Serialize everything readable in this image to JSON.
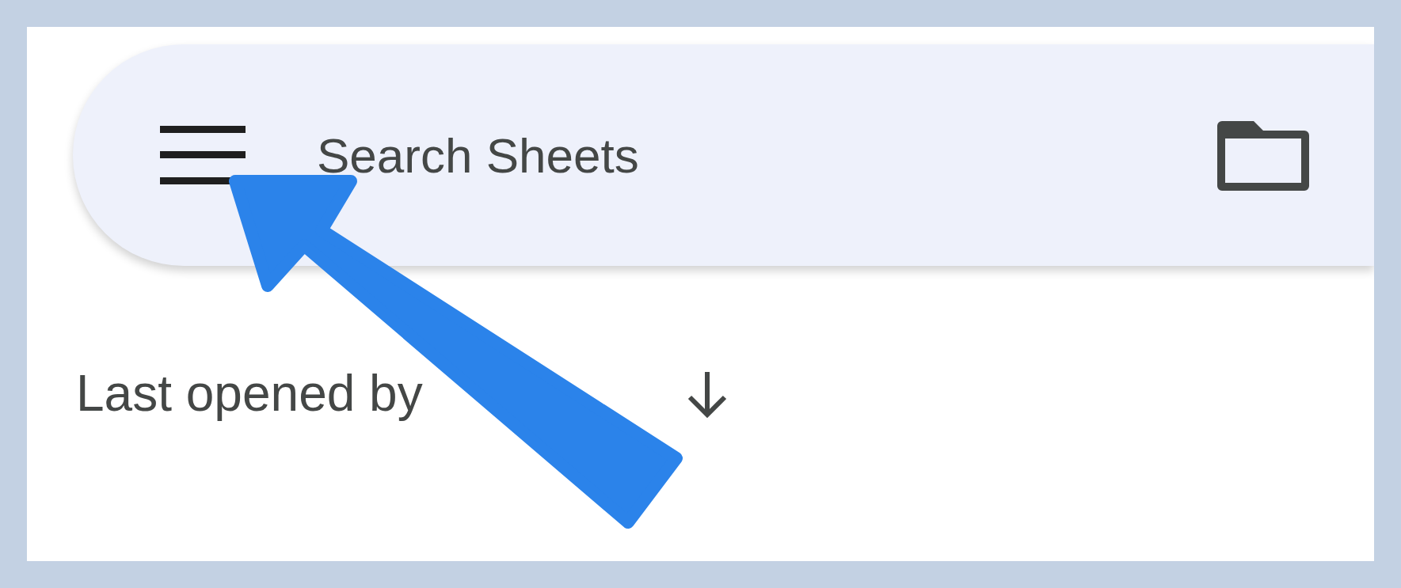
{
  "search_bar": {
    "placeholder": "Search Sheets"
  },
  "sort": {
    "label": "Last opened by"
  },
  "annotation": {
    "kind": "arrow"
  }
}
